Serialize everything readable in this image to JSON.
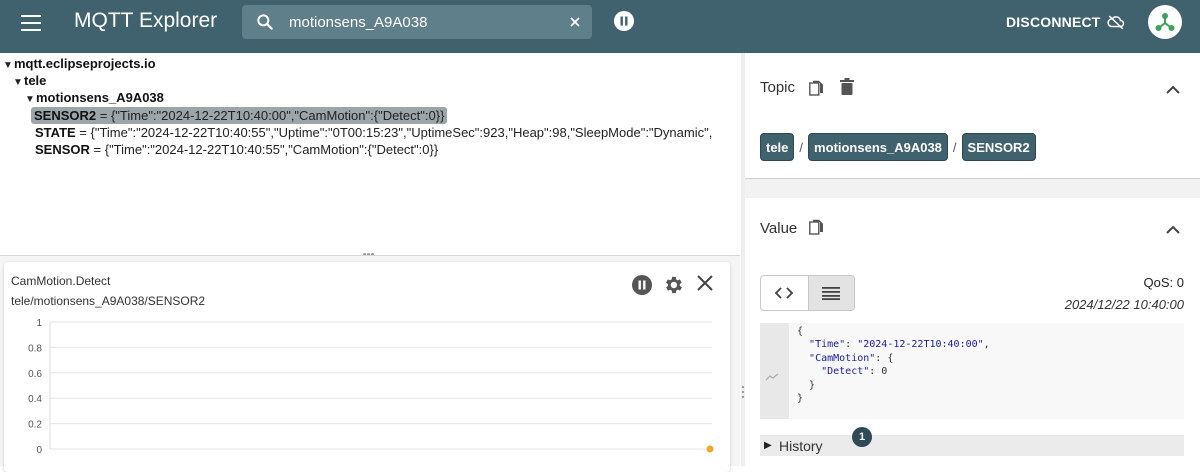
{
  "app": {
    "title": "MQTT Explorer"
  },
  "search": {
    "value": "motionsens_A9A038"
  },
  "header": {
    "disconnect_label": "DISCONNECT"
  },
  "tree": {
    "root": "mqtt.eclipseprojects.io",
    "level1": "tele",
    "level2": "motionsens_A9A038",
    "leaves": [
      {
        "key": "SENSOR2",
        "value": " = {\"Time\":\"2024-12-22T10:40:00\",\"CamMotion\":{\"Detect\":0}}"
      },
      {
        "key": "STATE",
        "value": " = {\"Time\":\"2024-12-22T10:40:55\",\"Uptime\":\"0T00:15:23\",\"UptimeSec\":923,\"Heap\":98,\"SleepMode\":\"Dynamic\","
      },
      {
        "key": "SENSOR",
        "value": " = {\"Time\":\"2024-12-22T10:40:55\",\"CamMotion\":{\"Detect\":0}}"
      }
    ]
  },
  "chart": {
    "title": "CamMotion.Detect",
    "topic": "tele/motionsens_A9A038/SENSOR2"
  },
  "chart_data": {
    "type": "line",
    "title": "CamMotion.Detect",
    "subtitle": "tele/motionsens_A9A038/SENSOR2",
    "y_ticks": [
      "1",
      "0.8",
      "0.6",
      "0.4",
      "0.2",
      "0"
    ],
    "ylim": [
      0,
      1
    ],
    "grid": true,
    "series": [
      {
        "values": [
          0
        ],
        "color": "#f5a623"
      }
    ]
  },
  "right": {
    "topic_label": "Topic",
    "breadcrumbs": [
      "tele",
      "motionsens_A9A038",
      "SENSOR2"
    ],
    "crumb_sep": "/",
    "value_label": "Value",
    "qos": "QoS: 0",
    "timestamp": "2024/12/22 10:40:00",
    "history_label": "History",
    "history_count": "1"
  },
  "colors": {
    "appbar": "#40626f",
    "accent": "#40626f",
    "series": "#f5a623"
  }
}
